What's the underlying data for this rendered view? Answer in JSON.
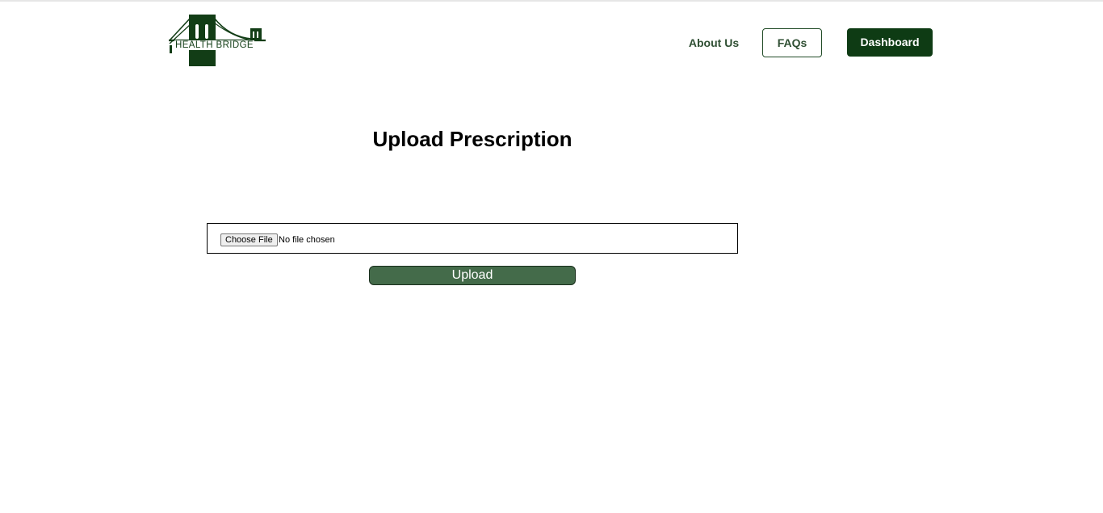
{
  "brand": {
    "name": "HEALTH BRIDGE",
    "color": "#123d16"
  },
  "nav": {
    "about_label": "About Us",
    "faqs_label": "FAQs",
    "dashboard_label": "Dashboard",
    "dashboard_color": "#0e3b14"
  },
  "main": {
    "title": "Upload Prescription",
    "file_input": {
      "button_label": "Choose File",
      "status_text": "No file chosen"
    },
    "upload_label": "Upload",
    "upload_color": "#446b4a"
  }
}
